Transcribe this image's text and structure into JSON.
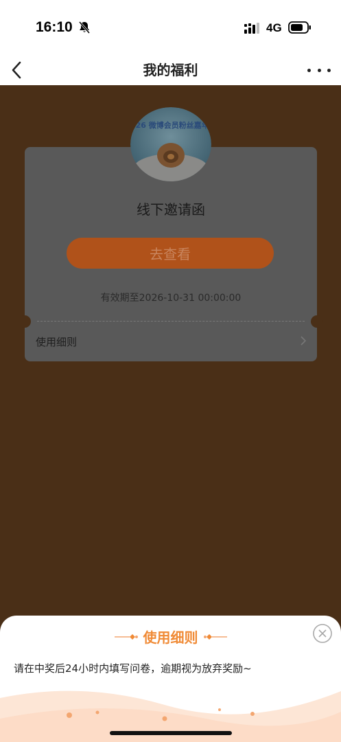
{
  "status_bar": {
    "time": "16:10",
    "network": "4G",
    "icons": [
      "bell-off-icon",
      "signal-icon",
      "battery-icon"
    ]
  },
  "nav": {
    "title": "我的福利",
    "icons": [
      "back-icon",
      "more-icon"
    ]
  },
  "benefit_card": {
    "badge_text": "2026 微博会员粉丝嘉年华",
    "name": "线下邀请函",
    "view_button": "去查看",
    "validity": "有效期至2026-10-31 00:00:00",
    "rules_label": "使用细则"
  },
  "rules_sheet": {
    "title": "使用细则",
    "content": "请在中奖后24小时内填写问卷，逾期视为放弃奖励~",
    "icons": [
      "close-icon"
    ]
  },
  "colors": {
    "overlay": "#4a2f17",
    "accent": "#f08a35",
    "button": "#b0521a"
  }
}
